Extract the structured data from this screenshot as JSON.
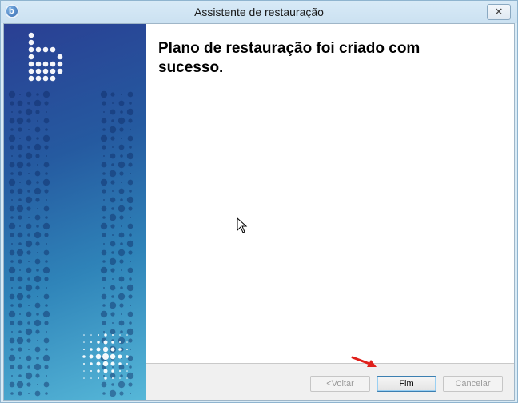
{
  "window": {
    "title": "Assistente de restauração",
    "close_label": "✕"
  },
  "main": {
    "heading": "Plano de restauração foi criado com sucesso."
  },
  "buttons": {
    "back_label": "<Voltar",
    "finish_label": "Fim",
    "cancel_label": "Cancelar"
  },
  "colors": {
    "sidebar_top": "#2a3f93",
    "sidebar_bottom": "#56b7d8",
    "annotation_arrow": "#e0201b"
  },
  "icons": [
    "app-logo-icon",
    "close-icon",
    "mouse-pointer-icon",
    "annotation-arrow-icon"
  ]
}
